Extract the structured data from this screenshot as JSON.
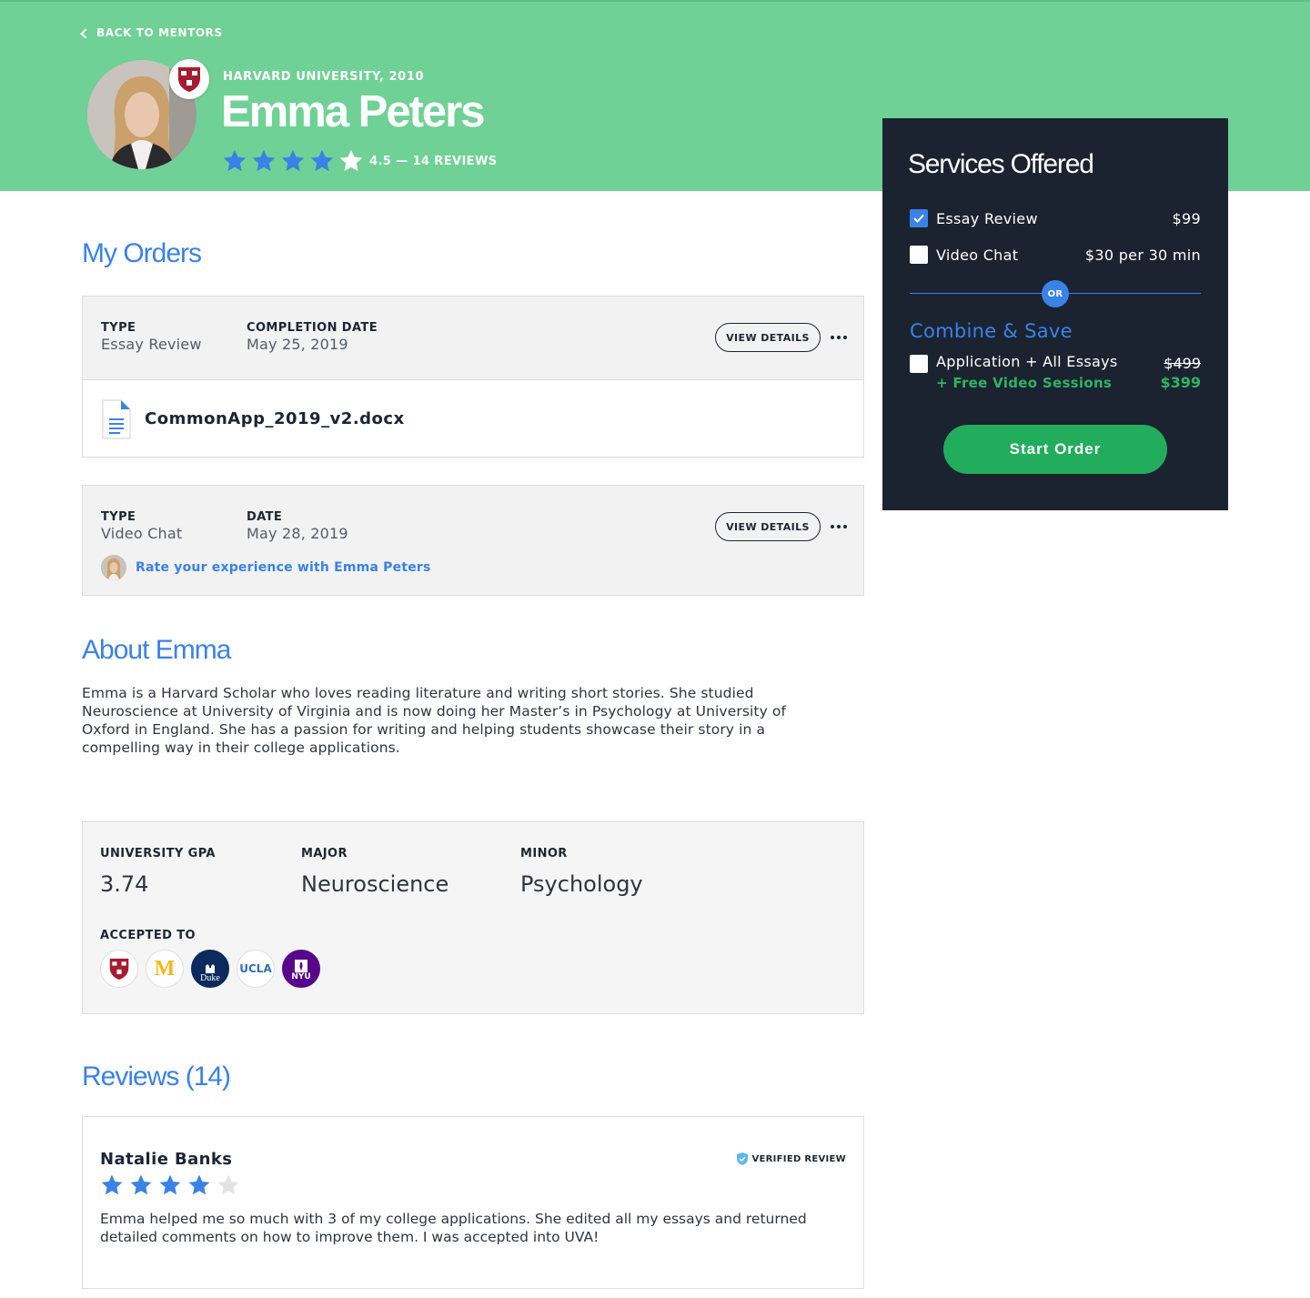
{
  "nav": {
    "back_label": "BACK TO MENTORS"
  },
  "mentor": {
    "school_year": "HARVARD UNIVERSITY, 2010",
    "name": "Emma Peters",
    "rating_text": "4.5 — 14 REVIEWS",
    "rating": 4.5
  },
  "orders": {
    "title": "My Orders",
    "items": [
      {
        "type_label": "TYPE",
        "type_value": "Essay Review",
        "date_label": "COMPLETION DATE",
        "date_value": "May 25, 2019",
        "action_label": "VIEW DETAILS",
        "file_name": "CommonApp_2019_v2.docx"
      },
      {
        "type_label": "TYPE",
        "type_value": "Video Chat",
        "date_label": "DATE",
        "date_value": "May 28, 2019",
        "action_label": "VIEW DETAILS",
        "rate_link": "Rate your experience with Emma Peters"
      }
    ]
  },
  "about": {
    "title": "About Emma",
    "text": "Emma is a Harvard Scholar who loves reading literature and writing short stories. She studied Neuroscience at University of Virginia and is now doing her Master’s in Psychology at University of Oxford in England. She has a passion for writing and helping students showcase their story in a compelling way in their college applications."
  },
  "stats": {
    "gpa_label": "UNIVERSITY GPA",
    "gpa_value": "3.74",
    "major_label": "MAJOR",
    "major_value": "Neuroscience",
    "minor_label": "MINOR",
    "minor_value": "Psychology",
    "accepted_label": "ACCEPTED TO",
    "schools": [
      {
        "name": "harvard",
        "logo_text": ""
      },
      {
        "name": "michigan",
        "logo_text": "M"
      },
      {
        "name": "duke",
        "logo_text": "Duke"
      },
      {
        "name": "ucla",
        "logo_text": "UCLA"
      },
      {
        "name": "nyu",
        "logo_text": "NYU"
      }
    ]
  },
  "reviews": {
    "title": "Reviews (14)",
    "items": [
      {
        "author": "Natalie Banks",
        "stars": 4,
        "verified_label": "VERIFIED REVIEW",
        "text": "Emma helped me so much with 3 of my college applications. She edited all my essays and returned detailed comments on how to improve them. I was accepted into UVA!"
      }
    ]
  },
  "services": {
    "title": "Services Offered",
    "options": [
      {
        "label": "Essay Review",
        "price": "$99",
        "checked": true
      },
      {
        "label": "Video Chat",
        "price": "$30 per 30 min",
        "checked": false
      }
    ],
    "or_label": "OR",
    "combine_title": "Combine & Save",
    "combo": {
      "label": "Application + All Essays",
      "sub": "+ Free Video Sessions",
      "old_price": "$499",
      "new_price": "$399",
      "checked": false
    },
    "start_label": "Start Order"
  },
  "colors": {
    "hero_green": "#6fd195",
    "accent_blue": "#3a82e8",
    "panel_navy": "#1b2331",
    "cta_green": "#22ad5c",
    "price_green": "#2db562"
  }
}
